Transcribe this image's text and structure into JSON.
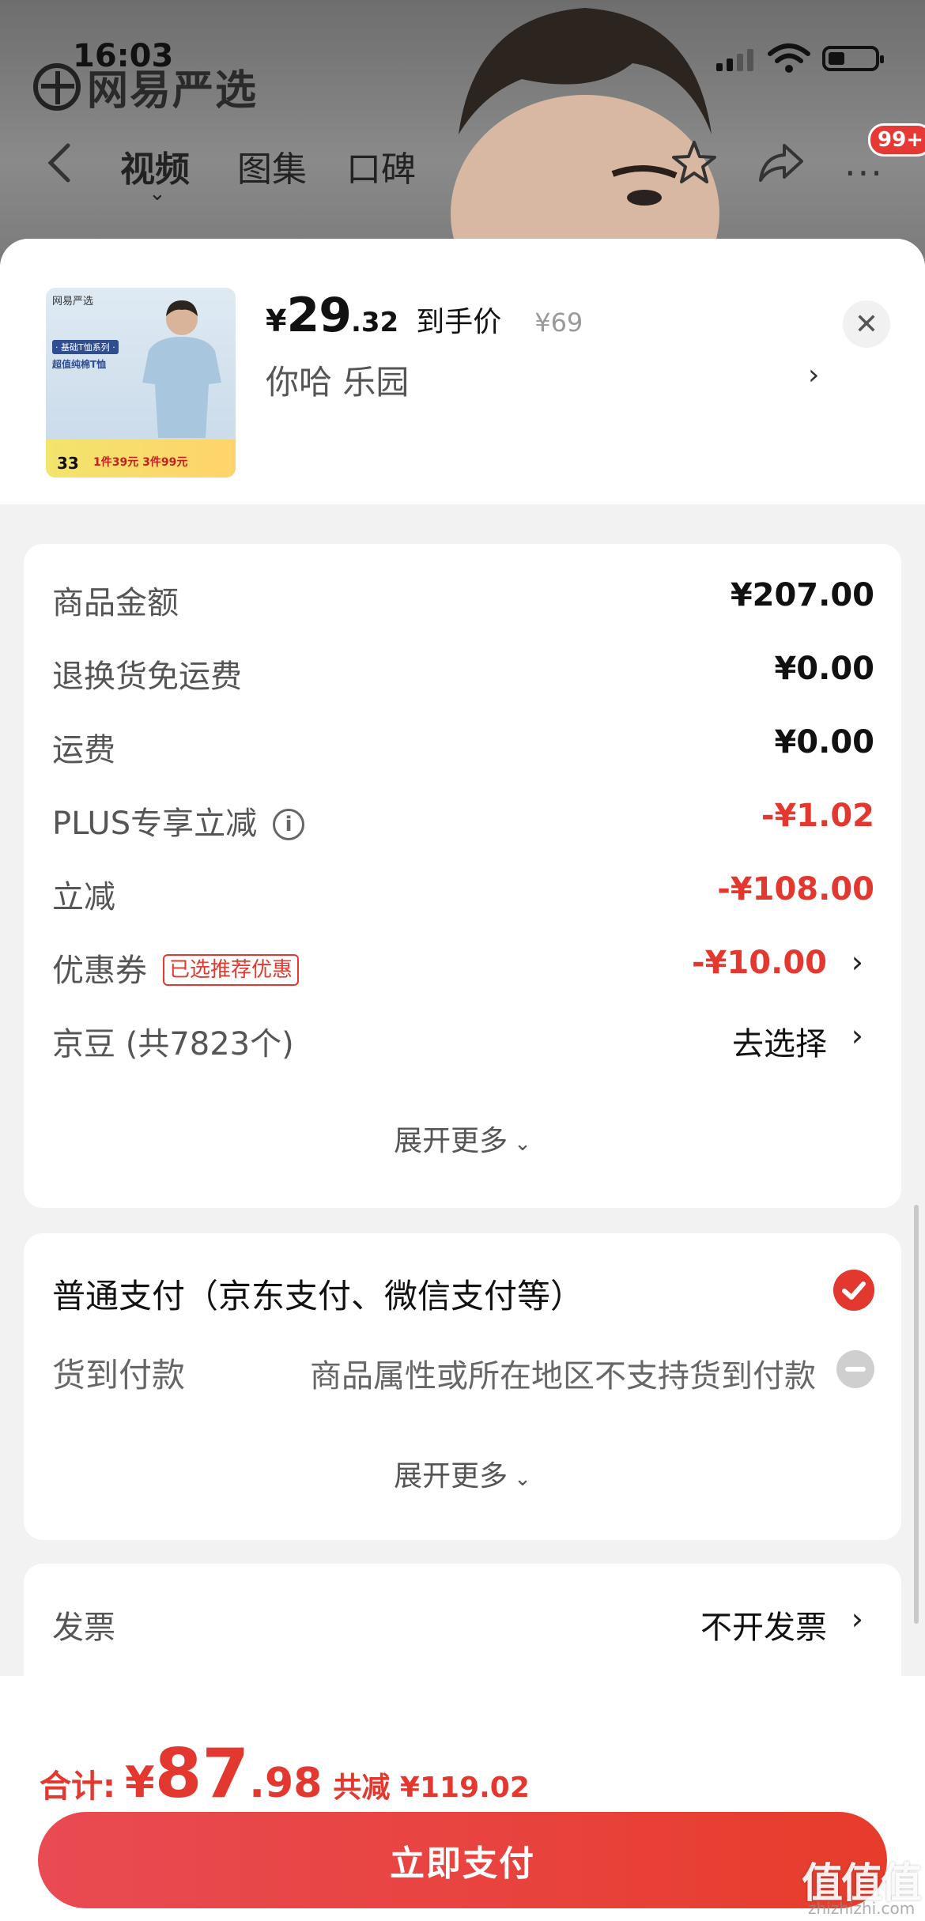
{
  "status": {
    "time": "16:03"
  },
  "brand": {
    "logo_text": "网易严选"
  },
  "nav": {
    "tabs": [
      "视频",
      "图集",
      "口碑"
    ],
    "active_tab": "视频",
    "badge": "99+",
    "icons": [
      "back-icon",
      "star-icon",
      "share-icon",
      "more-icon"
    ]
  },
  "product": {
    "price_currency": "¥",
    "price_int": "29",
    "price_dec": ".32",
    "price_label": "到手价",
    "original_price": "¥69",
    "spec": "你哈  乐园",
    "thumb": {
      "brand": "网易严选",
      "tag": "· 基础T恤系列 ·",
      "subtitle": "超值纯棉T恤",
      "price": "33",
      "promo": "1件39元 3件99元"
    }
  },
  "fees": [
    {
      "label": "商品金额",
      "value": "¥207.00",
      "red": false
    },
    {
      "label": "退换货免运费",
      "value": "¥0.00",
      "red": false
    },
    {
      "label": "运费",
      "value": "¥0.00",
      "red": false
    },
    {
      "label": "PLUS专享立减",
      "value": "-¥1.02",
      "red": true
    },
    {
      "label": "立减",
      "value": "-¥108.00",
      "red": true
    },
    {
      "label": "优惠券",
      "tag": "已选推荐优惠",
      "value": "-¥10.00",
      "red": true
    },
    {
      "label": "京豆 (共7823个)",
      "value": "去选择",
      "red": false
    }
  ],
  "expand_more": "展开更多",
  "payment": {
    "normal": "普通支付（京东支付、微信支付等）",
    "cod_label": "货到付款",
    "cod_note": "商品属性或所在地区不支持货到付款"
  },
  "invoice": {
    "label": "发票",
    "value": "不开发票"
  },
  "total": {
    "label": "合计:",
    "currency": "¥",
    "int": "87",
    "dec": ".98",
    "reduced": "共减 ¥119.02"
  },
  "pay_button": "立即支付",
  "watermark": {
    "main": "值值值",
    "sub": "zhizhizhi.com"
  },
  "colors": {
    "accent_red": "#e2382f",
    "button_red": "#e73c2c"
  }
}
